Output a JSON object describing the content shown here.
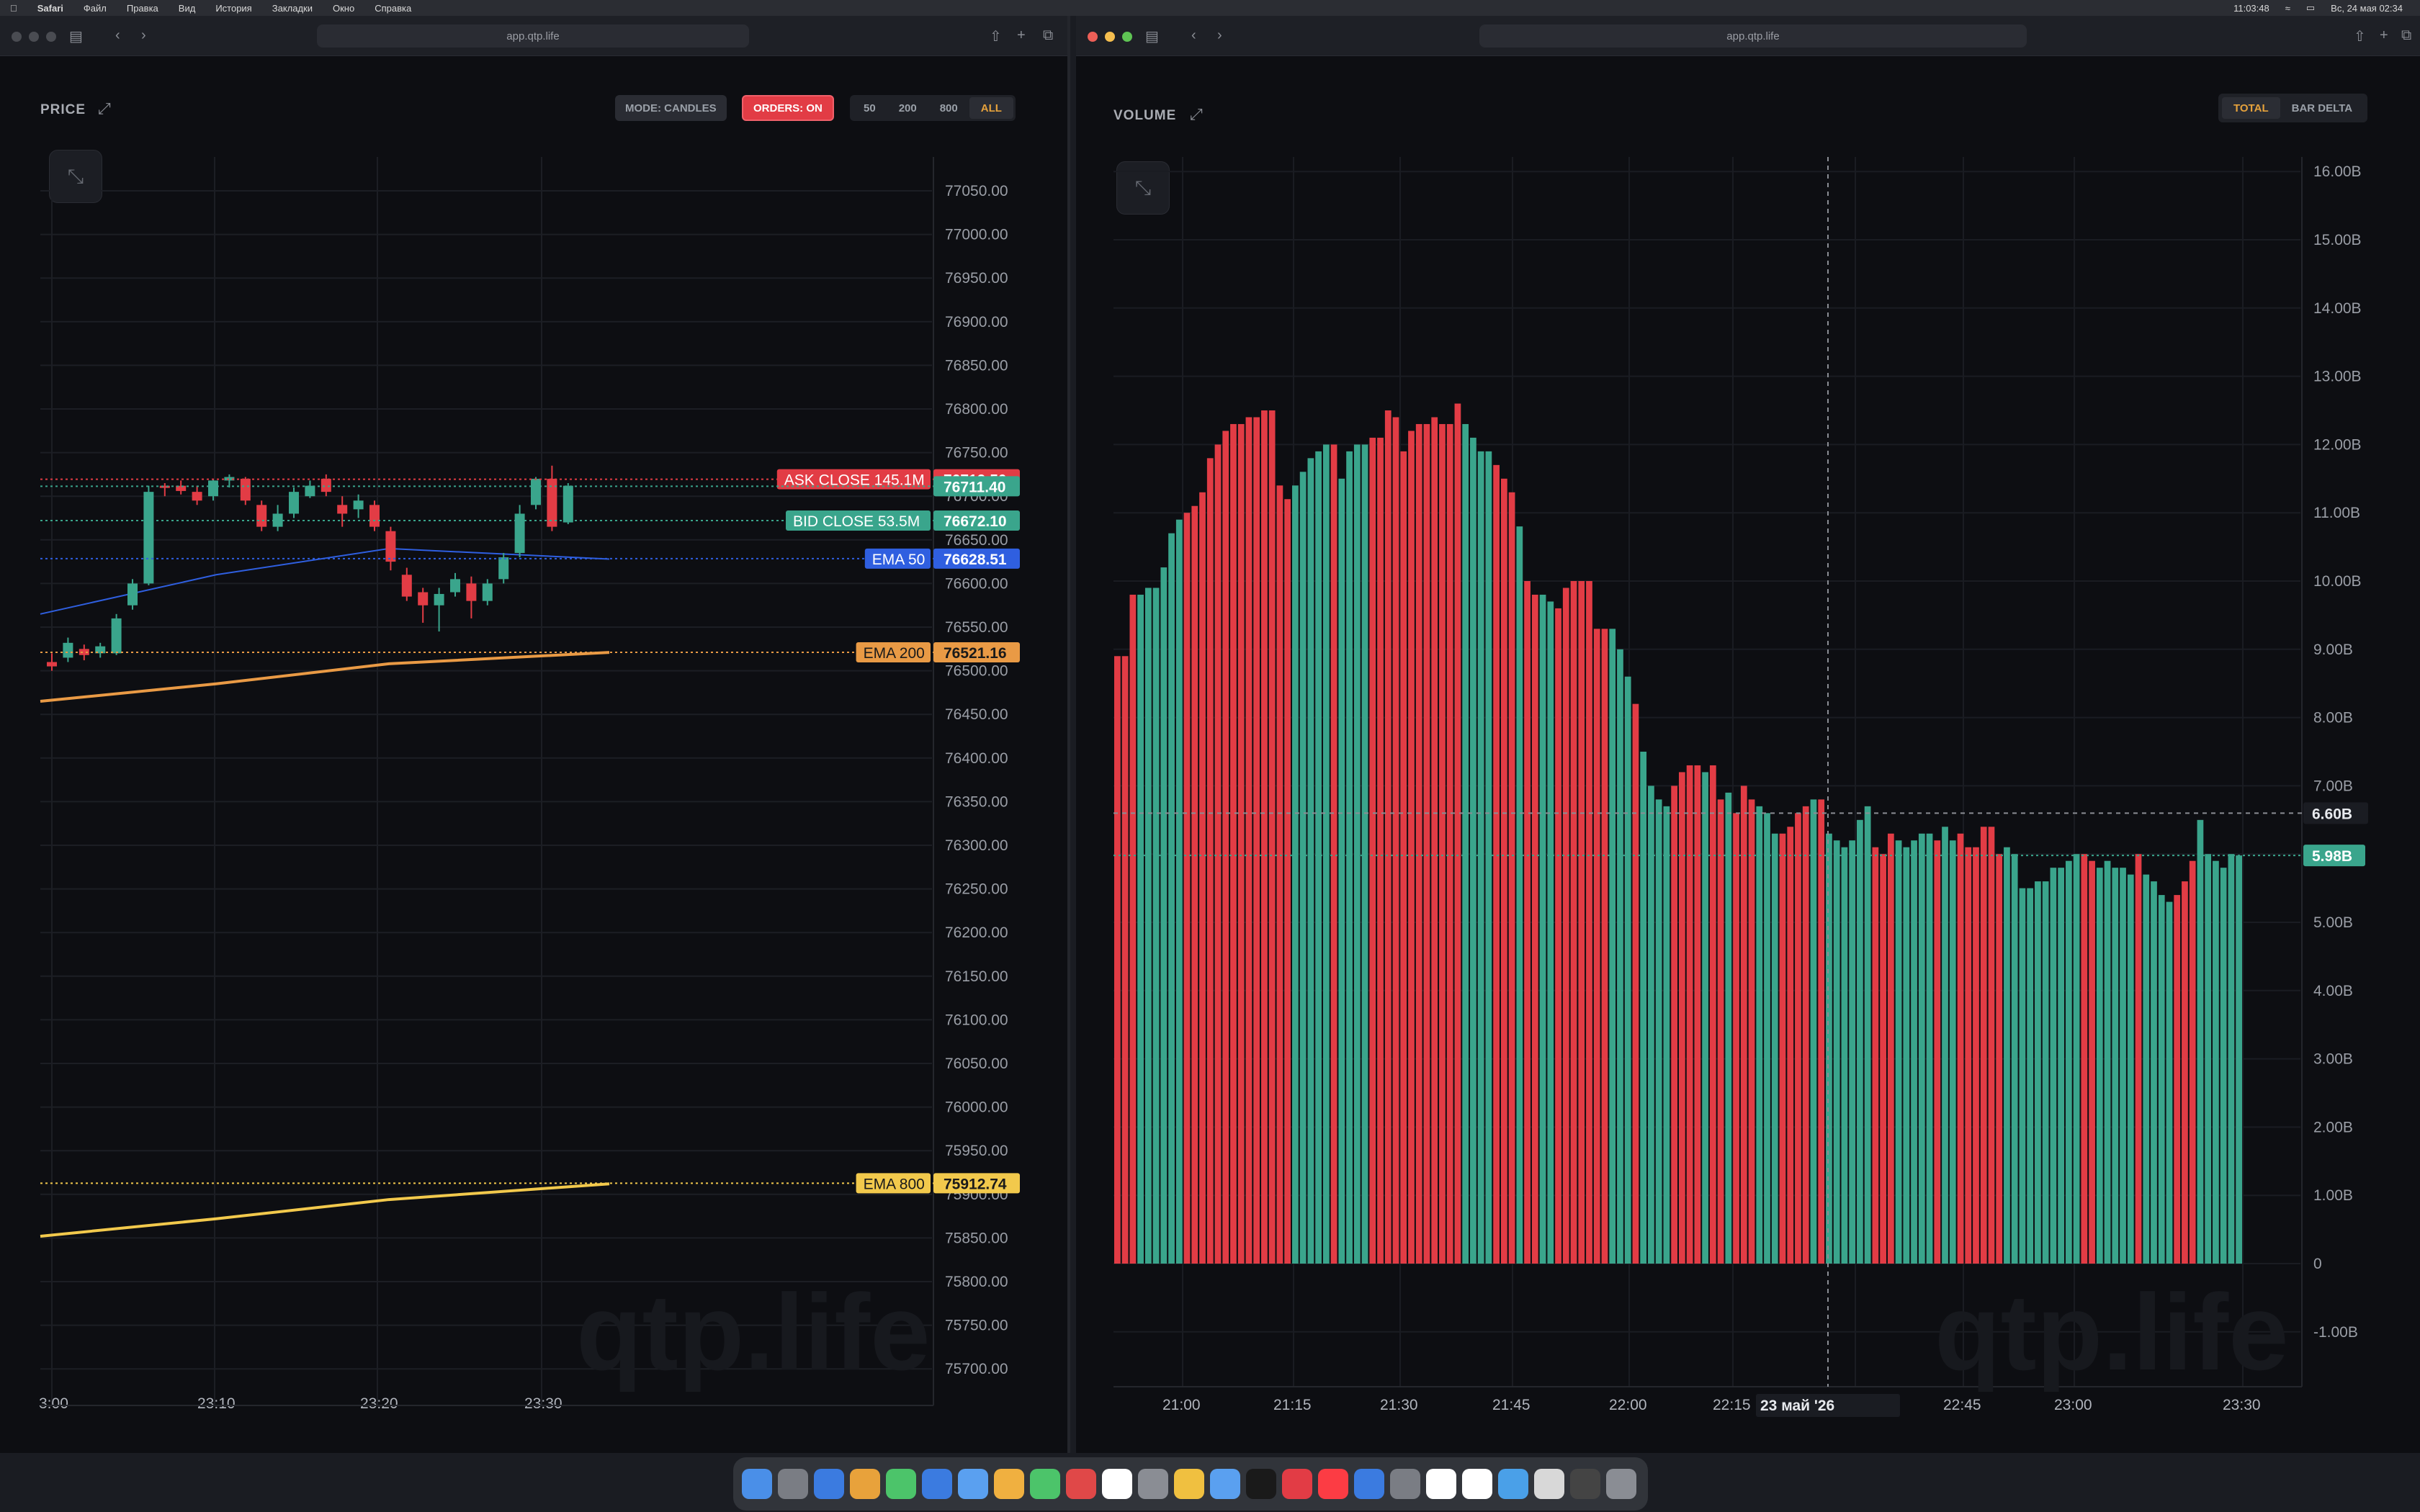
{
  "menubar": {
    "app": "Safari",
    "menus": [
      "Файл",
      "Правка",
      "Вид",
      "История",
      "Закладки",
      "Окно",
      "Справка"
    ],
    "timer": "11:03:48",
    "datetime": "Вс, 24 мая 02:34"
  },
  "windows": {
    "left_url": "app.qtp.life",
    "right_url": "app.qtp.life"
  },
  "price": {
    "title": "PRICE",
    "mode_label": "MODE: CANDLES",
    "orders_label": "ORDERS: ON",
    "ranges": [
      "50",
      "200",
      "800",
      "ALL"
    ],
    "active_range": "ALL",
    "y_ticks": [
      "77050.00",
      "77000.00",
      "76950.00",
      "76900.00",
      "76850.00",
      "76800.00",
      "76750.00",
      "76700.00",
      "76650.00",
      "76600.00",
      "76550.00",
      "76500.00",
      "76450.00",
      "76400.00",
      "76350.00",
      "76300.00",
      "76250.00",
      "76200.00",
      "76150.00",
      "76100.00",
      "76050.00",
      "76000.00",
      "75950.00",
      "75900.00",
      "75850.00",
      "75800.00",
      "75750.00",
      "75700.00"
    ],
    "x_ticks": [
      "3:00",
      "23:10",
      "23:20",
      "23:30"
    ],
    "labels": [
      {
        "name": "ASK CLOSE 145.1M",
        "value": "76719.50",
        "color": "#e23c45"
      },
      {
        "name": "",
        "value": "76711.40",
        "color": "#3aa58c"
      },
      {
        "name": "BID CLOSE 53.5M",
        "value": "76672.10",
        "color": "#3aa58c"
      },
      {
        "name": "EMA 50",
        "value": "76628.51",
        "color": "#2f5fe0"
      },
      {
        "name": "EMA 200",
        "value": "76521.16",
        "color": "#e99a45"
      },
      {
        "name": "EMA 800",
        "value": "75912.74",
        "color": "#f2c94c"
      }
    ],
    "watermark": "qtp.life"
  },
  "volume": {
    "title": "VOLUME",
    "tabs": [
      "TOTAL",
      "BAR DELTA"
    ],
    "active_tab": "TOTAL",
    "y_ticks": [
      "16.00B",
      "15.00B",
      "14.00B",
      "13.00B",
      "12.00B",
      "11.00B",
      "10.00B",
      "9.00B",
      "8.00B",
      "7.00B",
      "6.00B",
      "5.00B",
      "4.00B",
      "3.00B",
      "2.00B",
      "1.00B",
      "0",
      "-1.00B"
    ],
    "x_ticks": [
      "21:00",
      "21:15",
      "21:30",
      "21:45",
      "22:00",
      "22:15",
      "22:30",
      "22:45",
      "23:00",
      "23:30"
    ],
    "crosshair_date": "23 май '26",
    "crosshair_value": "6.60B",
    "last_value": "5.98B",
    "watermark": "qtp.life"
  },
  "chart_data": [
    {
      "type": "line",
      "title": "PRICE",
      "x": [
        "3:00",
        "23:10",
        "23:20",
        "23:30"
      ],
      "series": [
        {
          "name": "EMA 50",
          "values": [
            76565,
            76610,
            76640,
            76628
          ]
        },
        {
          "name": "EMA 200",
          "values": [
            76465,
            76485,
            76508,
            76521
          ]
        },
        {
          "name": "EMA 800",
          "values": [
            75852,
            75872,
            75894,
            75912
          ]
        }
      ],
      "ylim": [
        75680,
        77080
      ]
    },
    {
      "type": "bar",
      "title": "VOLUME",
      "ylim": [
        -1.2,
        16.2
      ],
      "ylabel": "",
      "values": [
        8.9,
        8.9,
        9.8,
        9.8,
        9.9,
        9.9,
        10.2,
        10.7,
        10.9,
        11.0,
        11.1,
        11.3,
        11.8,
        12.0,
        12.2,
        12.3,
        12.3,
        12.4,
        12.4,
        12.5,
        12.5,
        11.4,
        11.2,
        11.4,
        11.6,
        11.8,
        11.9,
        12.0,
        12.0,
        11.5,
        11.9,
        12.0,
        12.0,
        12.1,
        12.1,
        12.5,
        12.4,
        11.9,
        12.2,
        12.3,
        12.3,
        12.4,
        12.3,
        12.3,
        12.6,
        12.3,
        12.1,
        11.9,
        11.9,
        11.7,
        11.5,
        11.3,
        10.8,
        10.0,
        9.8,
        9.8,
        9.7,
        9.6,
        9.9,
        10.0,
        10.0,
        10.0,
        9.3,
        9.3,
        9.3,
        9.0,
        8.6,
        8.2,
        7.5,
        7.0,
        6.8,
        6.7,
        7.0,
        7.2,
        7.3,
        7.3,
        7.2,
        7.3,
        6.8,
        6.9,
        6.6,
        7.0,
        6.8,
        6.7,
        6.6,
        6.3,
        6.3,
        6.4,
        6.6,
        6.7,
        6.8,
        6.8,
        6.3,
        6.2,
        6.1,
        6.2,
        6.5,
        6.7,
        6.1,
        6.0,
        6.3,
        6.2,
        6.1,
        6.2,
        6.3,
        6.3,
        6.2,
        6.4,
        6.2,
        6.3,
        6.1,
        6.1,
        6.4,
        6.4,
        6.0,
        6.1,
        6.0,
        5.5,
        5.5,
        5.6,
        5.6,
        5.8,
        5.8,
        5.9,
        6.0,
        6.0,
        5.9,
        5.8,
        5.9,
        5.8,
        5.8,
        5.7,
        6.0,
        5.7,
        5.6,
        5.4,
        5.3,
        5.4,
        5.6,
        5.9,
        6.5,
        6.0,
        5.9,
        5.8,
        6.0,
        5.98
      ],
      "colors_pattern": "red/green per bar"
    }
  ]
}
